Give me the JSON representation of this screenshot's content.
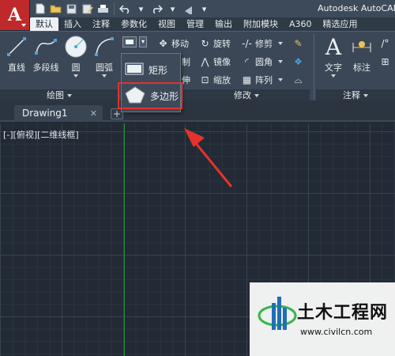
{
  "app": {
    "title": "Autodesk AutoCAD",
    "logo_letter": "A"
  },
  "ribbon_tabs": [
    "默认",
    "插入",
    "注释",
    "参数化",
    "视图",
    "管理",
    "输出",
    "附加模块",
    "A360",
    "精选应用"
  ],
  "active_tab": "默认",
  "draw_panel": {
    "footer": "绘图",
    "buttons": [
      {
        "label": "直线",
        "icon": "line-icon"
      },
      {
        "label": "多段线",
        "icon": "polyline-icon"
      },
      {
        "label": "圆",
        "icon": "circle-icon"
      },
      {
        "label": "圆弧",
        "icon": "arc-icon"
      }
    ]
  },
  "modify_panel": {
    "footer": "修改",
    "items": [
      {
        "label": "移动",
        "icon": "move-icon"
      },
      {
        "label": "旋转",
        "icon": "rotate-icon"
      },
      {
        "label": "修剪",
        "icon": "trim-icon"
      },
      {
        "label": "复制",
        "icon": "copy-icon"
      },
      {
        "label": "镜像",
        "icon": "mirror-icon"
      },
      {
        "label": "圆角",
        "icon": "fillet-icon"
      },
      {
        "label": "拉伸",
        "icon": "stretch-icon"
      },
      {
        "label": "缩放",
        "icon": "scale-icon"
      },
      {
        "label": "阵列",
        "icon": "array-icon"
      }
    ]
  },
  "annotation_panel": {
    "footer": "注释",
    "buttons": [
      {
        "label": "文字",
        "icon": "text-icon"
      },
      {
        "label": "标注",
        "icon": "dimension-icon"
      }
    ]
  },
  "dropdown": {
    "items": [
      {
        "label": "矩形",
        "icon": "rectangle-icon"
      },
      {
        "label": "多边形",
        "icon": "polygon-icon"
      }
    ],
    "highlighted": "多边形"
  },
  "document": {
    "tab_name": "Drawing1",
    "viewport_label": "[-][俯视][二维线框]"
  },
  "watermark": {
    "title": "土木工程网",
    "url": "www.civilcn.com"
  },
  "colors": {
    "app_button": "#c0292b",
    "highlight_border": "#e5322d",
    "annotation_arrow": "#e5322d",
    "y_axis": "#2f8a3a",
    "canvas_bg": "#222a35"
  }
}
